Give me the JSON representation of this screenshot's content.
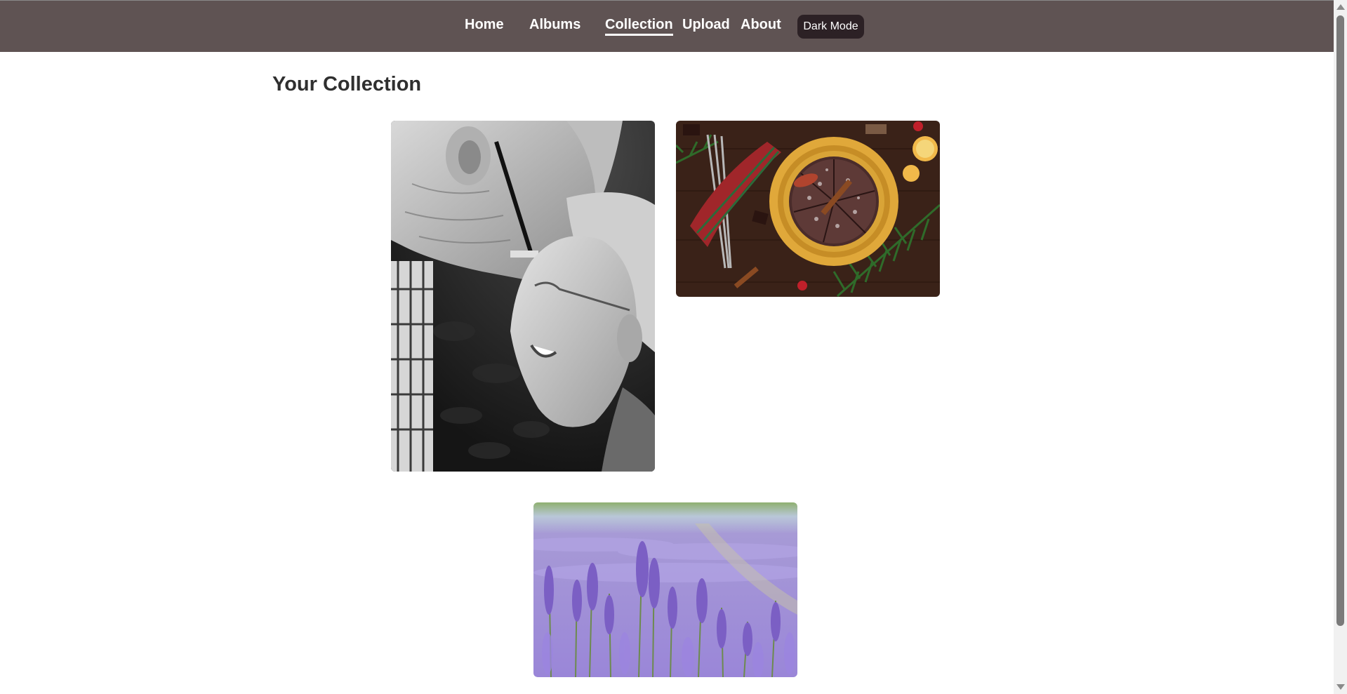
{
  "nav": {
    "items": [
      {
        "label": "Home"
      },
      {
        "label": "Albums"
      },
      {
        "label": "Collection",
        "active": true
      },
      {
        "label": "Upload"
      },
      {
        "label": "About"
      }
    ],
    "dark_mode_label": "Dark Mode",
    "background_color": "#5f5353"
  },
  "main": {
    "title": "Your Collection",
    "photos": [
      {
        "subject": "elderly couple black and white portrait"
      },
      {
        "subject": "chocolate cake with cinnamon on festive table"
      },
      {
        "subject": "lavender field"
      }
    ]
  }
}
